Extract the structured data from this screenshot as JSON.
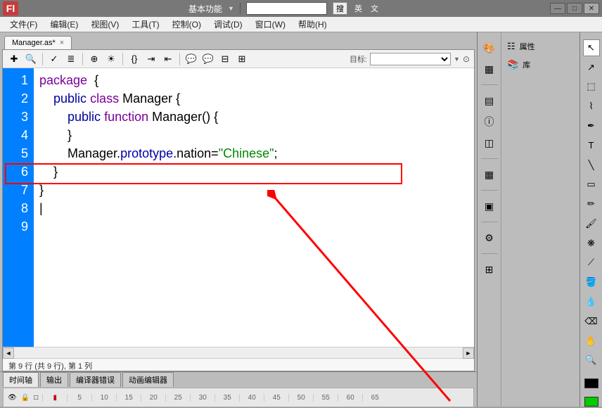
{
  "titlebar": {
    "logo": "Fl",
    "feature": "基本功能",
    "search_placeholder": "",
    "search_btn": "搜",
    "lang1": "英",
    "lang2": "文"
  },
  "menu": {
    "file": "文件(F)",
    "edit": "编辑(E)",
    "view": "视图(V)",
    "tools": "工具(T)",
    "control": "控制(O)",
    "debug": "调试(D)",
    "window": "窗口(W)",
    "help": "帮助(H)"
  },
  "tab": {
    "name": "Manager.as*",
    "close": "×"
  },
  "toolbar": {
    "target_label": "目标:",
    "target_value": ""
  },
  "code": {
    "lines": [
      "1",
      "2",
      "3",
      "4",
      "5",
      "6",
      "7",
      "8",
      "9"
    ],
    "l1_kw": "package",
    "l1_brace": "  {",
    "l2_pad": "    ",
    "l2_public": "public",
    "l2_sp": " ",
    "l2_class": "class",
    "l2_name": " Manager {",
    "l3_pad": "        ",
    "l3_public": "public",
    "l3_sp": " ",
    "l3_function": "function",
    "l3_name": " Manager() {",
    "l4": "",
    "l5": "        }",
    "l6_pad": "        Manager.",
    "l6_proto": "prototype",
    "l6_mid": ".nation=",
    "l6_str": "\"Chinese\"",
    "l6_end": ";",
    "l7": "    }",
    "l8": "}",
    "l9": "|"
  },
  "status": "第 9 行 (共 9 行), 第 1 列",
  "bottom": {
    "timeline": "时间轴",
    "output": "输出",
    "compiler": "编译器错误",
    "anim": "动画编辑器",
    "ticks": [
      "5",
      "10",
      "15",
      "20",
      "25",
      "30",
      "35",
      "40",
      "45",
      "50",
      "55",
      "60",
      "65"
    ]
  },
  "panels": {
    "properties": "属性",
    "library": "库"
  }
}
